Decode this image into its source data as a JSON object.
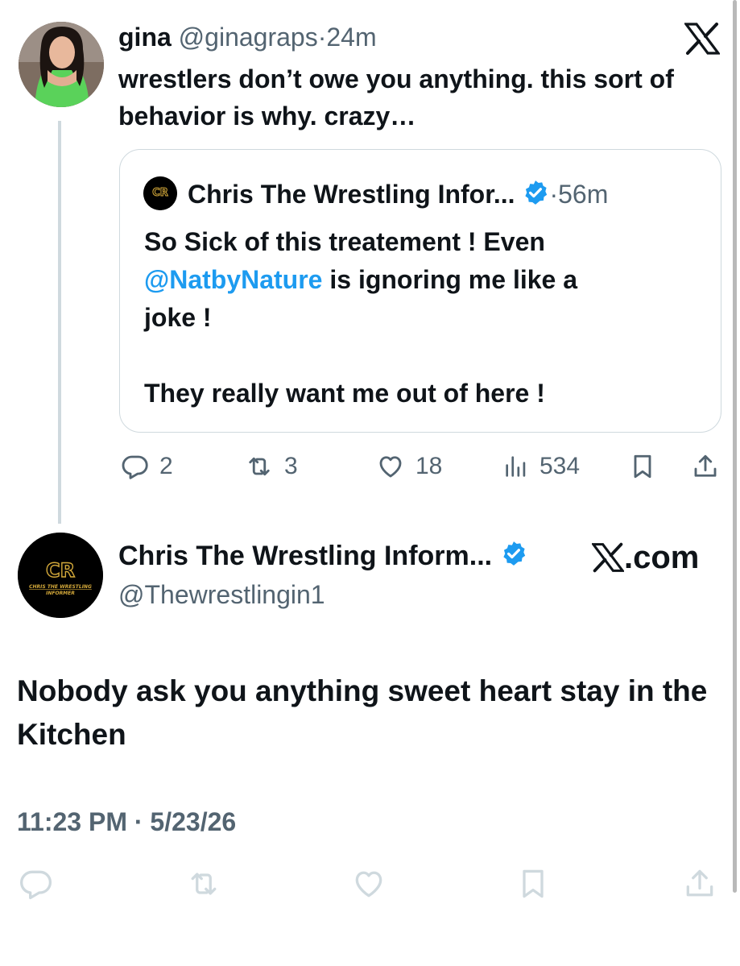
{
  "parent_tweet": {
    "author_name": "gina",
    "author_handle": "@ginagraps",
    "separator": "·",
    "time_ago": "24m",
    "text": "wrestlers don’t owe you anything. this sort of behavior is why. crazy…",
    "quoted_tweet": {
      "author_name": "Chris The Wrestling Infor...",
      "separator": "·",
      "time_ago": "56m",
      "line1": "So Sick of this treatement ! Even",
      "mention": "@NatbyNature",
      "line2_rest": " is ignoring me like a",
      "line3": "joke !",
      "line5": "They really want me out of here !"
    },
    "actions": {
      "replies": "2",
      "reposts": "3",
      "likes": "18",
      "views": "534"
    }
  },
  "reply_tweet": {
    "author_name": "Chris The Wrestling Inform...",
    "author_handle": "@Thewrestlingin1",
    "site_label": ".com",
    "text": "Nobody ask you anything sweet heart stay in the Kitchen",
    "timestamp": "11:23 PM · 5/23/26"
  },
  "avatar_logo": {
    "monogram": "CR",
    "caption_line1": "CHRIS THE WRESTLING",
    "caption_line2": "INFORMER"
  },
  "colors": {
    "text": "#0f1419",
    "secondary": "#536471",
    "accent": "#1d9bf0",
    "border": "#cfd9de",
    "logo_gold": "#d4a93a"
  },
  "icons": [
    "x-logo-icon",
    "verified-badge-icon",
    "reply-icon",
    "repost-icon",
    "like-icon",
    "views-icon",
    "bookmark-icon",
    "share-icon"
  ]
}
